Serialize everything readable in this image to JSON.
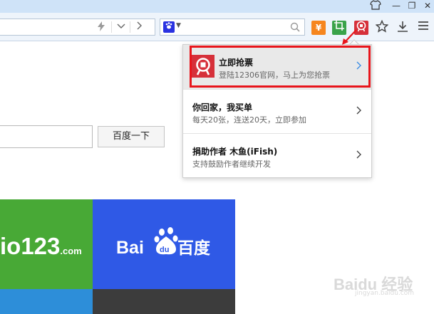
{
  "window": {
    "skin_icon": "shirt-icon",
    "minimize": "—",
    "maximize": "❐",
    "close": "✕"
  },
  "toolbar": {
    "address_value": "",
    "search_value": "",
    "extensions": [
      {
        "name": "yen-icon",
        "glyph": "¥",
        "color": "#f6861f"
      },
      {
        "name": "crop-icon",
        "glyph": "⌗",
        "color": "#3aa34a"
      },
      {
        "name": "train-ticket-icon",
        "glyph": "⌂",
        "color": "#d6303a"
      }
    ]
  },
  "page": {
    "search_button": "百度一下",
    "tile_logo_123": "io123",
    "tile_logo_123_suffix": ".com",
    "tile_logo_baidu_prefix": "Bai",
    "tile_logo_baidu_du": "du",
    "tile_logo_baidu_cn": "百度"
  },
  "popup": {
    "items": [
      {
        "title": "立即抢票",
        "desc": "登陆12306官网，马上为您抢票"
      },
      {
        "title": "你回家，我买单",
        "desc": "每天20张，连送20天，立即参加"
      },
      {
        "title": "捐助作者 木鱼(iFish)",
        "desc": "支持鼓励作者继续开发"
      }
    ]
  },
  "watermark": {
    "brand": "Baidu 经验",
    "url": "jingyan.baidu.com"
  },
  "colors": {
    "highlight": "#e8151b",
    "tile_green": "#48a936",
    "tile_blue": "#2f59e6",
    "train_red": "#d6303a"
  }
}
